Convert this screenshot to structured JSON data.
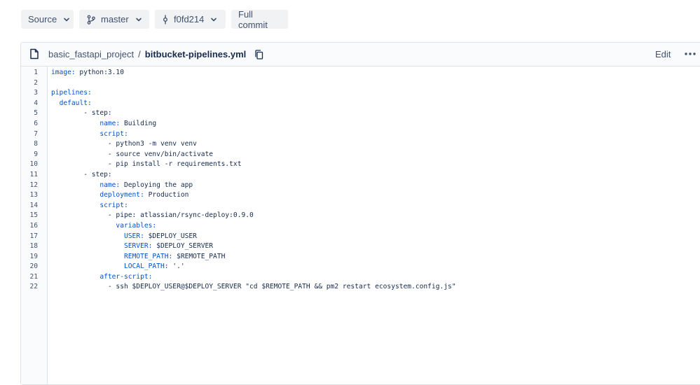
{
  "toolbar": {
    "source_label": "Source",
    "branch_label": "master",
    "commit_label": "f0fd214",
    "full_commit_label": "Full commit"
  },
  "file": {
    "project": "basic_fastapi_project",
    "separator": "/",
    "filename": "bitbucket-pipelines.yml",
    "edit_label": "Edit"
  },
  "code_lines": [
    {
      "n": "1",
      "indent": 0,
      "key": "image:",
      "rest": " python:3.10"
    },
    {
      "n": "2",
      "indent": 0,
      "key": "",
      "rest": ""
    },
    {
      "n": "3",
      "indent": 0,
      "key": "pipelines:",
      "rest": ""
    },
    {
      "n": "4",
      "indent": 2,
      "key": "default:",
      "rest": ""
    },
    {
      "n": "5",
      "indent": 8,
      "key": "",
      "rest": "- step:"
    },
    {
      "n": "6",
      "indent": 12,
      "key": "name:",
      "rest": " Building"
    },
    {
      "n": "7",
      "indent": 12,
      "key": "script:",
      "rest": ""
    },
    {
      "n": "8",
      "indent": 14,
      "key": "",
      "rest": "- python3 -m venv venv"
    },
    {
      "n": "9",
      "indent": 14,
      "key": "",
      "rest": "- source venv/bin/activate"
    },
    {
      "n": "10",
      "indent": 14,
      "key": "",
      "rest": "- pip install -r requirements.txt"
    },
    {
      "n": "11",
      "indent": 8,
      "key": "",
      "rest": "- step:"
    },
    {
      "n": "12",
      "indent": 12,
      "key": "name:",
      "rest": " Deploying the app"
    },
    {
      "n": "13",
      "indent": 12,
      "key": "deployment:",
      "rest": " Production"
    },
    {
      "n": "14",
      "indent": 12,
      "key": "script:",
      "rest": ""
    },
    {
      "n": "15",
      "indent": 14,
      "key": "",
      "rest": "- pipe: atlassian/rsync-deploy:0.9.0"
    },
    {
      "n": "16",
      "indent": 16,
      "key": "variables:",
      "rest": ""
    },
    {
      "n": "17",
      "indent": 18,
      "key": "USER:",
      "rest": " $DEPLOY_USER"
    },
    {
      "n": "18",
      "indent": 18,
      "key": "SERVER:",
      "rest": " $DEPLOY_SERVER"
    },
    {
      "n": "19",
      "indent": 18,
      "key": "REMOTE_PATH:",
      "rest": " $REMOTE_PATH"
    },
    {
      "n": "20",
      "indent": 18,
      "key": "LOCAL_PATH:",
      "rest": " '.'"
    },
    {
      "n": "21",
      "indent": 12,
      "key": "after-script:",
      "rest": ""
    },
    {
      "n": "22",
      "indent": 14,
      "key": "",
      "rest": "- ssh $DEPLOY_USER@$DEPLOY_SERVER \"cd $REMOTE_PATH && pm2 restart ecosystem.config.js\""
    }
  ],
  "colors": {
    "key": "#0052cc",
    "text": "#172b4d",
    "line_number": "#42526e",
    "button_bg": "#f1f2f4",
    "border": "#dfe1e6"
  },
  "icons": [
    "chevron-down-icon",
    "branch-icon",
    "commit-icon",
    "file-icon",
    "copy-icon",
    "more-icon"
  ]
}
